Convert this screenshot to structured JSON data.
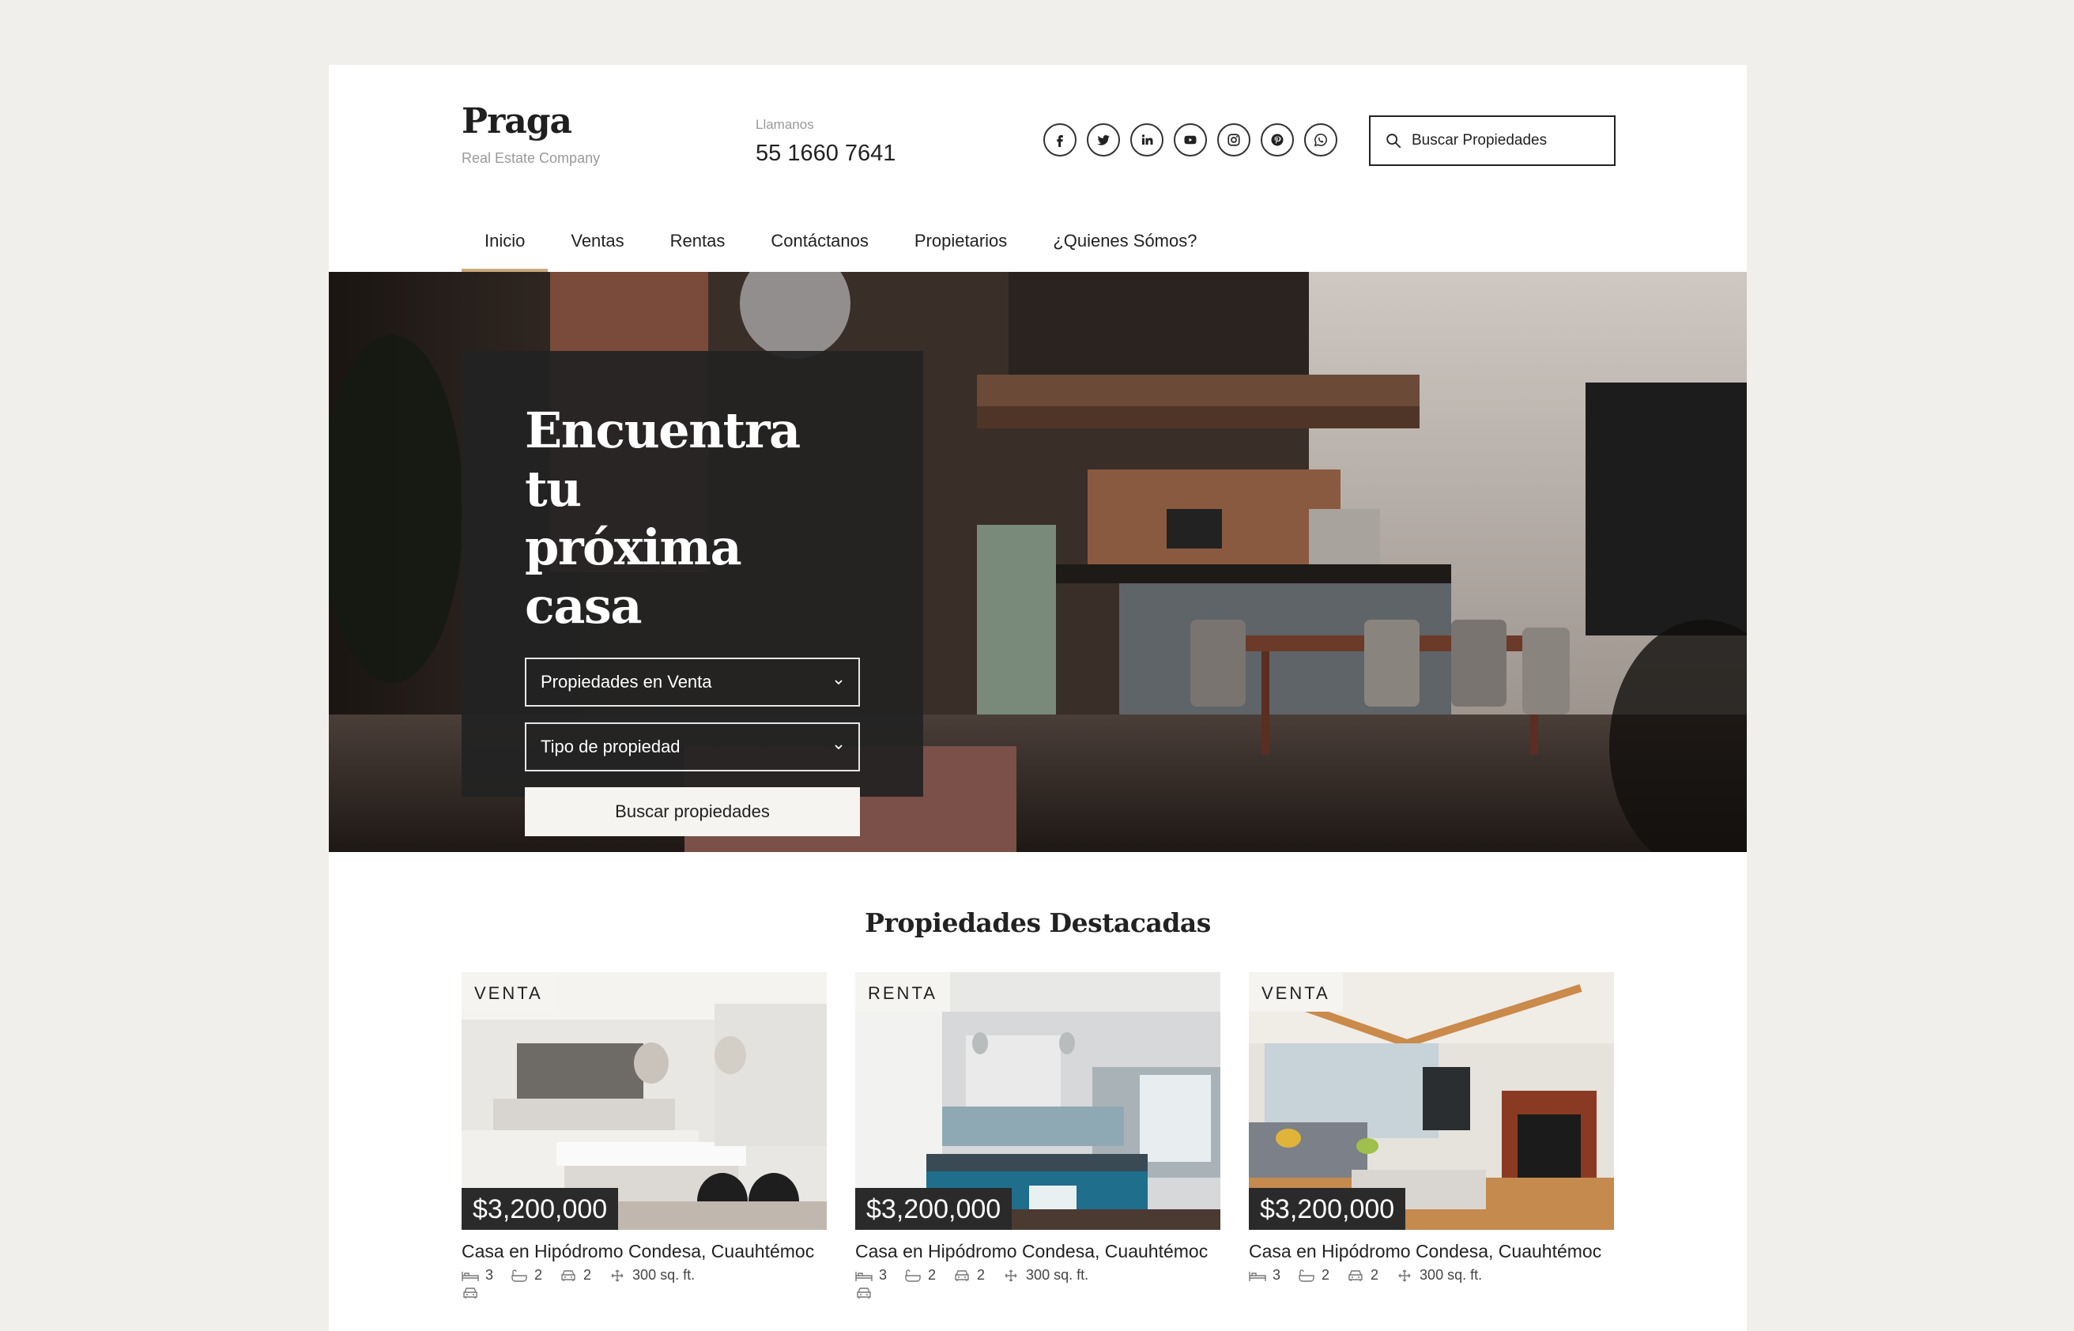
{
  "brand": {
    "name": "Praga",
    "tagline": "Real Estate Company"
  },
  "contact": {
    "label": "Llamanos",
    "phone": "55 1660 7641"
  },
  "socials": [
    {
      "icon": "facebook-icon"
    },
    {
      "icon": "twitter-icon"
    },
    {
      "icon": "linkedin-icon"
    },
    {
      "icon": "youtube-icon"
    },
    {
      "icon": "instagram-icon"
    },
    {
      "icon": "pinterest-icon"
    },
    {
      "icon": "whatsapp-icon"
    }
  ],
  "search": {
    "placeholder": "Buscar Propiedades"
  },
  "nav": {
    "items": [
      {
        "label": "Inicio",
        "active": true
      },
      {
        "label": "Ventas"
      },
      {
        "label": "Rentas"
      },
      {
        "label": "Contáctanos"
      },
      {
        "label": "Propietarios"
      },
      {
        "label": "¿Quienes Sómos?"
      }
    ]
  },
  "hero": {
    "title_line1": "Encuentra tu",
    "title_line2": "próxima casa",
    "select_operation": "Propiedades en Venta",
    "select_type": "Tipo de propiedad",
    "button": "Buscar propiedades"
  },
  "featured": {
    "title": "Propiedades Destacadas",
    "cards": [
      {
        "badge": "VENTA",
        "price": "$3,200,000",
        "title": "Casa en Hipódromo Condesa, Cuauhtémoc",
        "beds": "3",
        "baths": "2",
        "parking": "2",
        "area": "300 sq. ft."
      },
      {
        "badge": "RENTA",
        "price": "$3,200,000",
        "title": "Casa en Hipódromo Condesa, Cuauhtémoc",
        "beds": "3",
        "baths": "2",
        "parking": "2",
        "area": "300 sq. ft."
      },
      {
        "badge": "VENTA",
        "price": "$3,200,000",
        "title": "Casa en Hipódromo Condesa, Cuauhtémoc",
        "beds": "3",
        "baths": "2",
        "parking": "2",
        "area": "300 sq. ft."
      }
    ]
  },
  "colors": {
    "background": "#f1efeb",
    "accent": "#c9a97c",
    "dark": "#222222"
  }
}
